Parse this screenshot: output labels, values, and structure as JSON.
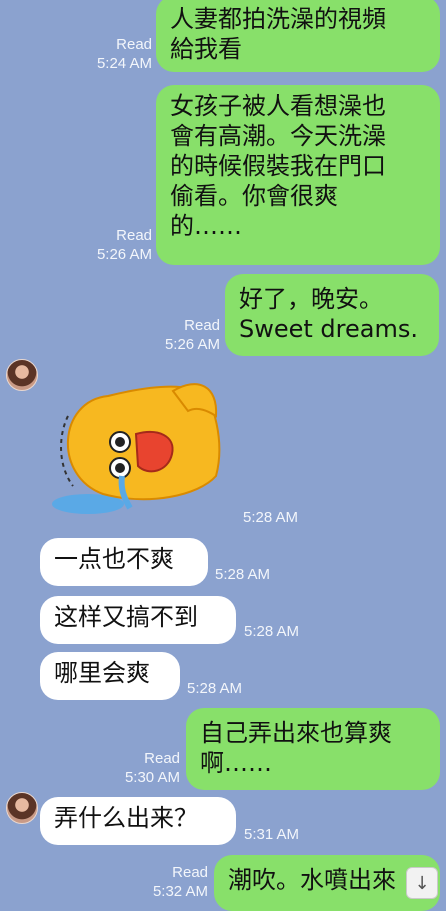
{
  "messages": [
    {
      "dir": "out",
      "text": "人妻都拍洗澡的視頻\n給我看",
      "read": "Read",
      "time": "5:24 AM"
    },
    {
      "dir": "out",
      "text": "女孩子被人看想澡也\n會有高潮。今天洗澡\n的時候假裝我在門口\n偷看。你會很爽\n的……",
      "read": "Read",
      "time": "5:26 AM"
    },
    {
      "dir": "out",
      "text": "好了，晚安。\nSweet dreams.",
      "read": "Read",
      "time": "5:26 AM"
    },
    {
      "dir": "in",
      "type": "sticker",
      "sticker": "crying-chick-sticker",
      "time": "5:28 AM"
    },
    {
      "dir": "in",
      "text": "一点也不爽",
      "time": "5:28 AM"
    },
    {
      "dir": "in",
      "text": "这样又搞不到",
      "time": "5:28 AM"
    },
    {
      "dir": "in",
      "text": "哪里会爽",
      "time": "5:28 AM"
    },
    {
      "dir": "out",
      "text": "自己弄出來也算爽\n啊……",
      "read": "Read",
      "time": "5:30 AM"
    },
    {
      "dir": "in",
      "text": "弄什么出来？",
      "time": "5:31 AM"
    },
    {
      "dir": "out",
      "text": "潮吹。水噴出來",
      "read": "Read",
      "time": "5:32 AM"
    }
  ],
  "scroll_button_icon": "arrow-down-icon",
  "scroll_button_glyph": "↓"
}
